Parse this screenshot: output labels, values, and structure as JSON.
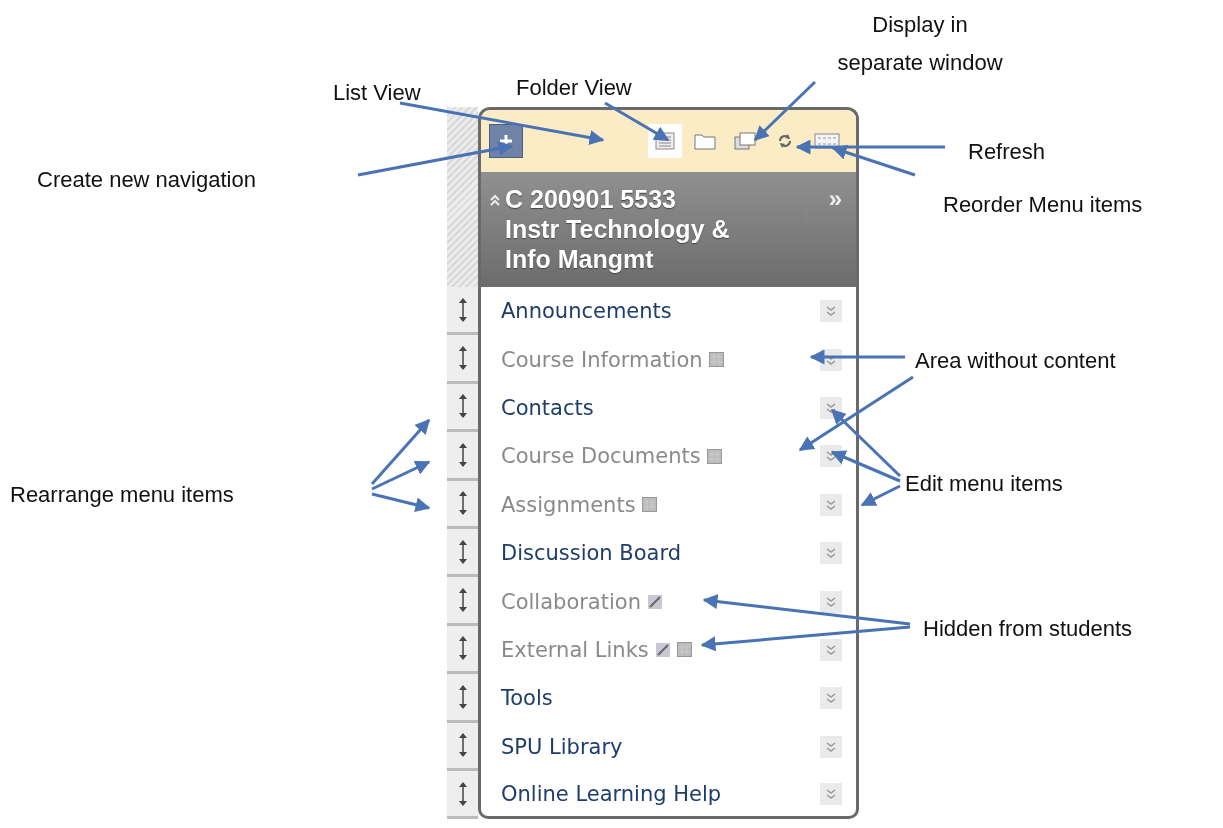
{
  "toolbar": {
    "tools": [
      {
        "kind": "list",
        "selected": true
      },
      {
        "kind": "folder",
        "selected": false
      },
      {
        "kind": "window",
        "selected": false
      },
      {
        "kind": "refresh",
        "selected": false
      },
      {
        "kind": "reorder",
        "selected": false
      }
    ]
  },
  "header": {
    "title": "C 200901 5533 Instr Technology & Info Mangmt",
    "expand": "»"
  },
  "menu": {
    "items": [
      {
        "label": "Announcements",
        "available": true,
        "empty": false,
        "hidden": false
      },
      {
        "label": "Course Information",
        "available": false,
        "empty": true,
        "hidden": false
      },
      {
        "label": "Contacts",
        "available": true,
        "empty": false,
        "hidden": false
      },
      {
        "label": "Course Documents",
        "available": false,
        "empty": true,
        "hidden": false
      },
      {
        "label": "Assignments",
        "available": false,
        "empty": true,
        "hidden": false
      },
      {
        "label": "Discussion Board",
        "available": true,
        "empty": false,
        "hidden": false
      },
      {
        "label": "Collaboration",
        "available": false,
        "empty": false,
        "hidden": true
      },
      {
        "label": "External Links",
        "available": false,
        "empty": true,
        "hidden": true
      },
      {
        "label": "Tools",
        "available": true,
        "empty": false,
        "hidden": false
      },
      {
        "label": "SPU Library",
        "available": true,
        "empty": false,
        "hidden": false
      },
      {
        "label": "Online Learning Help",
        "available": true,
        "empty": false,
        "hidden": false
      }
    ]
  },
  "callouts": [
    {
      "text": "List View"
    },
    {
      "text": "Folder View"
    },
    {
      "text": "Display in separate window"
    },
    {
      "text": "Refresh"
    },
    {
      "text": "Reorder Menu items"
    },
    {
      "text": "Create new navigation"
    },
    {
      "text": "Area without content"
    },
    {
      "text": "Rearrange menu items"
    },
    {
      "text": "Edit menu items"
    },
    {
      "text": "Hidden from students"
    }
  ]
}
